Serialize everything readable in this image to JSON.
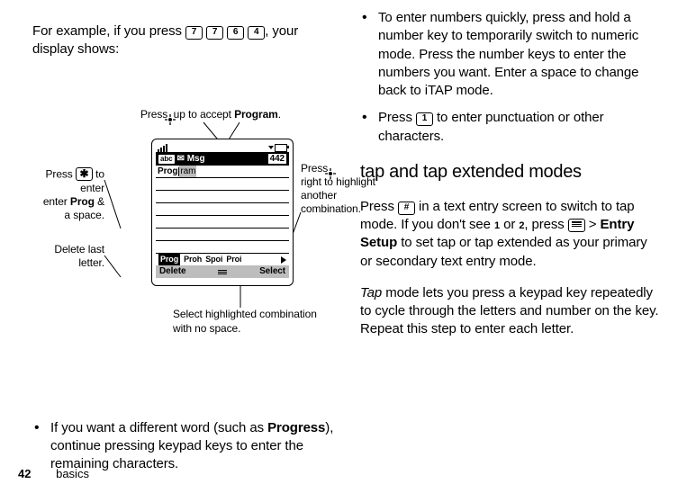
{
  "left": {
    "intro_prefix": "For example, if you press ",
    "keys": [
      "7",
      "7",
      "6",
      "4"
    ],
    "intro_suffix": ", your display shows:",
    "bullet1_a": "If you want a different word (such as ",
    "bullet1_bold": "Progress",
    "bullet1_b": "), continue pressing keypad keys to enter the remaining characters."
  },
  "diagram": {
    "top_callout_a": "Press ",
    "top_callout_b": " up to accept ",
    "top_callout_bold": "Program",
    "top_callout_c": ".",
    "left_callout_a": "Press ",
    "left_key": "✱",
    "left_callout_b": " to enter ",
    "left_bold": "Prog",
    "left_callout_c": " & a space.",
    "delete_callout": "Delete last letter.",
    "right_callout_a": "Press ",
    "right_callout_b": " right to highlight another combination.",
    "bottom_callout": "Select highlighted combination with no space.",
    "phone": {
      "mode": "abc",
      "title_icon": "✉",
      "title": "Msg",
      "count": "442",
      "typed_bold": "Prog",
      "typed_grey": "ram",
      "candidates": [
        "Prog",
        "Proh",
        "Spoi",
        "Proi"
      ],
      "soft_left": "Delete",
      "soft_right": "Select"
    }
  },
  "right": {
    "bullet1": "To enter numbers quickly, press and hold a number key to temporarily switch to numeric mode. Press the number keys to enter the numbers you want. Enter a space to change back to iTAP mode.",
    "bullet2_a": "Press ",
    "bullet2_key": "1",
    "bullet2_b": " to enter punctuation or other characters.",
    "heading": "tap and tap extended modes",
    "p1_a": "Press ",
    "p1_key": "#",
    "p1_b": " in a text entry screen to switch to tap mode. If you don't see ",
    "p1_icon1": "1",
    "p1_c": " or ",
    "p1_icon2": "2",
    "p1_d": ", press ",
    "p1_menukey": "▭",
    "p1_e": " > ",
    "p1_bold": "Entry Setup",
    "p1_f": " to set tap or tap extended as your primary or secondary text entry mode.",
    "p2_ital": "Tap",
    "p2_rest": " mode lets you press a keypad key repeatedly to cycle through the letters and number on the key. Repeat this step to enter each letter."
  },
  "footer": {
    "page": "42",
    "section": "basics"
  }
}
